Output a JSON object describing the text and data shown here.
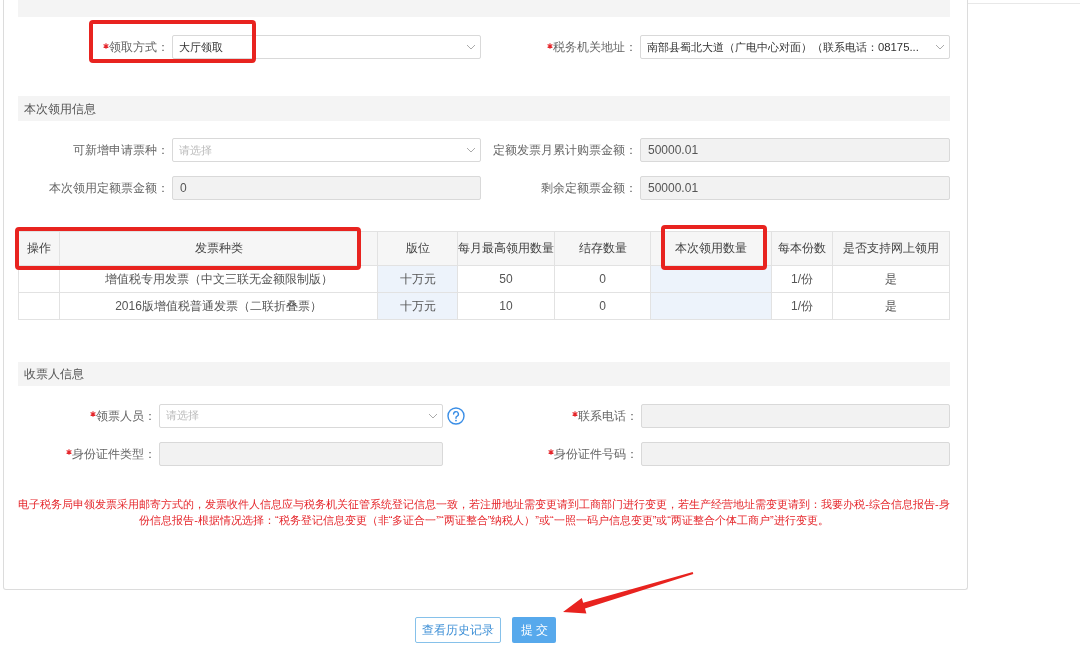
{
  "sections": [
    {
      "fields": [
        {
          "label": "领取方式：",
          "required": true,
          "help": false,
          "kind": "select",
          "value": "大厅领取"
        },
        {
          "label": "税务机关地址：",
          "required": true,
          "help": false,
          "kind": "select",
          "value": "南部县蜀北大道（广电中心对面）（联系电话：08175..."
        }
      ]
    },
    {
      "title": "本次领用信息",
      "fields": [
        {
          "label": "可新增申请票种：",
          "required": false,
          "help": false,
          "kind": "select",
          "placeholder": "请选择"
        },
        {
          "label": "定额发票月累计购票金额：",
          "required": false,
          "help": false,
          "kind": "readonly",
          "value": "50000.01"
        },
        {
          "label": "本次领用定额票金额：",
          "required": false,
          "help": false,
          "kind": "readonly",
          "value": "0"
        },
        {
          "label": "剩余定额票金额：",
          "required": false,
          "help": false,
          "kind": "readonly",
          "value": "50000.01"
        }
      ],
      "table": {
        "columns": [
          {
            "label": "操作",
            "kind": "action"
          },
          {
            "label": "发票种类",
            "kind": "text"
          },
          {
            "label": "版位",
            "kind": "select"
          },
          {
            "label": "每月最高领用数量",
            "kind": "text"
          },
          {
            "label": "结存数量",
            "kind": "text"
          },
          {
            "label": "本次领用数量",
            "kind": "input"
          },
          {
            "label": "每本份数",
            "kind": "text"
          },
          {
            "label": "是否支持网上领用",
            "kind": "text"
          }
        ],
        "rows": [
          {
            "cells": [
              "",
              "增值税专用发票（中文三联无金额限制版）",
              "十万元",
              "50",
              "0",
              "",
              "1/份",
              "是"
            ]
          },
          {
            "cells": [
              "",
              "2016版增值税普通发票（二联折叠票）",
              "十万元",
              "10",
              "0",
              "",
              "1/份",
              "是"
            ]
          }
        ]
      }
    },
    {
      "title": "收票人信息",
      "fields": [
        {
          "label": "领票人员：",
          "required": true,
          "help": true,
          "kind": "select",
          "placeholder": "请选择"
        },
        {
          "label": "联系电话：",
          "required": true,
          "help": false,
          "kind": "readonly"
        },
        {
          "label": "身份证件类型：",
          "required": true,
          "help": false,
          "kind": "readonly"
        },
        {
          "label": "身份证件号码：",
          "required": true,
          "help": false,
          "kind": "readonly"
        }
      ],
      "notice": "电子税务局申领发票采用邮寄方式的，发票收件人信息应与税务机关征管系统登记信息一致，若注册地址需变更请到工商部门进行变更，若生产经营地址需变更请到：我要办税-综合信息报告-身份信息报告-根据情况选择：“税务登记信息变更（非“多证合一”“两证整合”纳税人）”或“一照一码户信息变更”或“两证整合个体工商户”进行变更。"
    }
  ],
  "buttons": [
    {
      "label": "查看历史记录",
      "kind": "secondary"
    },
    {
      "label": "提交",
      "kind": "primary"
    }
  ]
}
